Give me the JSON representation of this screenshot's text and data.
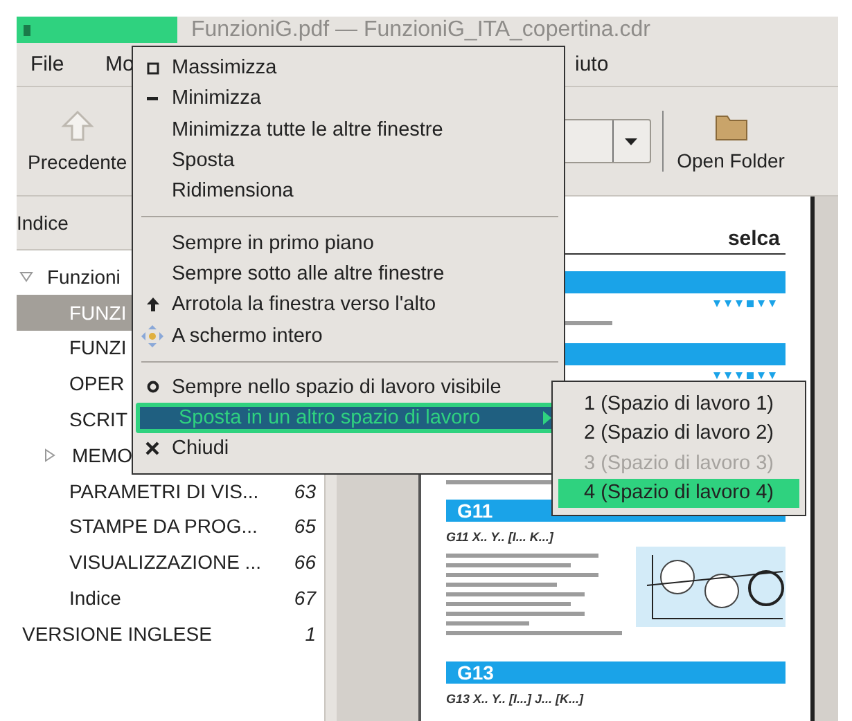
{
  "window": {
    "title": "FunzioniG.pdf — FunzioniG_ITA_copertina.cdr"
  },
  "menu_bar": [
    "File",
    "Mo",
    "iuto"
  ],
  "toolbar": {
    "back_button": "Precedente",
    "open_folder_button": "Open Folder"
  },
  "sidebar": {
    "title": "Indice",
    "tree": [
      {
        "kind": "branch",
        "label": "Funzioni",
        "expanded": true,
        "selected": false,
        "children": [
          {
            "kind": "leaf",
            "label": "FUNZI",
            "selected": true
          },
          {
            "kind": "leaf",
            "label": "FUNZI",
            "selected": false
          },
          {
            "kind": "leaf",
            "label": "OPER",
            "selected": false
          },
          {
            "kind": "leaf",
            "label": "SCRIT",
            "selected": false
          },
          {
            "kind": "branch",
            "label": "MEMO",
            "expanded": false,
            "selected": false
          },
          {
            "kind": "leaf",
            "label": "PARAMETRI DI VIS...",
            "page": "63",
            "selected": false
          },
          {
            "kind": "leaf",
            "label": "STAMPE DA PROG...",
            "page": "65",
            "selected": false
          },
          {
            "kind": "leaf",
            "label": "VISUALIZZAZIONE ...",
            "page": "66",
            "selected": false
          },
          {
            "kind": "leaf",
            "label": "Indice",
            "page": "67",
            "selected": false
          }
        ]
      },
      {
        "kind": "leaf",
        "label": "VERSIONE INGLESE",
        "page": "1",
        "selected": false
      }
    ]
  },
  "window_menu": [
    {
      "kind": "maximize",
      "label": "Massimizza",
      "selected": false
    },
    {
      "kind": "minimize",
      "label": "Minimizza",
      "selected": false
    },
    {
      "kind": "item",
      "label": "Minimizza tutte le altre finestre",
      "selected": false
    },
    {
      "kind": "item",
      "label": "Sposta",
      "selected": false
    },
    {
      "kind": "item",
      "label": "Ridimensiona",
      "selected": false
    },
    {
      "kind": "separator"
    },
    {
      "kind": "item",
      "label": "Sempre in primo piano",
      "selected": false
    },
    {
      "kind": "item",
      "label": "Sempre sotto alle altre finestre",
      "selected": false
    },
    {
      "kind": "shade",
      "label": "Arrotola la finestra verso l'alto",
      "selected": false
    },
    {
      "kind": "fullscreen",
      "label": "A schermo intero",
      "selected": false
    },
    {
      "kind": "separator"
    },
    {
      "kind": "sticky",
      "label": "Sempre nello spazio di lavoro visibile",
      "selected": false
    },
    {
      "kind": "submenu",
      "label": "Sposta in un altro spazio di lavoro",
      "selected": true
    },
    {
      "kind": "close",
      "label": "Chiudi",
      "selected": false
    }
  ],
  "workspace_submenu": [
    {
      "label": "1 (Spazio di lavoro 1)",
      "disabled": false,
      "selected": false
    },
    {
      "label": "2 (Spazio di lavoro 2)",
      "disabled": false,
      "selected": false
    },
    {
      "label": "3 (Spazio di lavoro 3)",
      "disabled": true,
      "selected": false
    },
    {
      "label": "4 (Spazio di lavoro 4)",
      "disabled": false,
      "selected": true
    }
  ],
  "document": {
    "brand": "selca",
    "sections": [
      {
        "code": "G11",
        "syntax": "G11 X.. Y.. [I... K...]"
      },
      {
        "code": "G13",
        "syntax": "G13 X.. Y.. [I...] J... [K...]"
      }
    ]
  }
}
